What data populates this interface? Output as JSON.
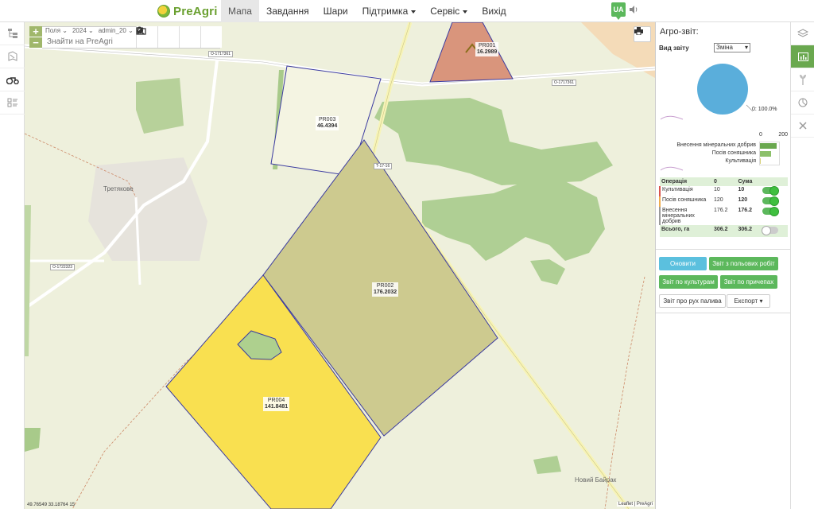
{
  "app": {
    "logo_text": "PreAgri"
  },
  "nav": {
    "items": [
      {
        "label": "Мапа",
        "active": true,
        "dropdown": false
      },
      {
        "label": "Завдання",
        "active": false,
        "dropdown": false
      },
      {
        "label": "Шари",
        "active": false,
        "dropdown": false
      },
      {
        "label": "Підтримка",
        "active": false,
        "dropdown": true
      },
      {
        "label": "Сервіс",
        "active": false,
        "dropdown": true
      },
      {
        "label": "Вихід",
        "active": false,
        "dropdown": false
      }
    ],
    "lang": "UA"
  },
  "left_toolbar": {
    "icons": [
      "fields-tree-icon",
      "map-layers-icon",
      "tractor-icon",
      "fields-list-icon"
    ]
  },
  "map": {
    "zoom_in": "+",
    "zoom_out": "−",
    "filters": {
      "type": "Поля",
      "year": "2024",
      "user": "admin_20"
    },
    "search_placeholder": "Знайти на PreAgri",
    "tools": [
      "search-icon",
      "locate-icon",
      "ruler-icon",
      "folder-icon"
    ],
    "fields": [
      {
        "id": "PR001",
        "area": "16.2989"
      },
      {
        "id": "PR002",
        "area": "176.2032"
      },
      {
        "id": "PR003",
        "area": "46.4394"
      },
      {
        "id": "PR004",
        "area": "141.8481"
      }
    ],
    "roads": [
      "O-1717361",
      "O-1717361",
      "O-1722323",
      "T-17-16"
    ],
    "places": [
      "Третякове",
      "Новий Байрак"
    ],
    "coordinates": "49.76549 33.18764 15",
    "attribution": "Leaflet | PreAgri"
  },
  "report": {
    "title": "Агро-звіт:",
    "view_label": "Вид звіту",
    "view_value": "Зміна",
    "pie": {
      "label": "0: 100.0%",
      "color": "#5aaedb"
    },
    "bar_axis": [
      "0",
      "200"
    ],
    "bars": [
      {
        "label": "Внесення мінеральних добрив",
        "value": 176.2
      },
      {
        "label": "Посів соняшника",
        "value": 120
      },
      {
        "label": "Культивація",
        "value": 10
      }
    ],
    "table": {
      "headers": [
        "Операція",
        "0",
        "Сума"
      ],
      "rows": [
        {
          "name": "Культивація",
          "value": "10",
          "sum": "10",
          "color": "#d9534f",
          "enabled": true
        },
        {
          "name": "Посів соняшника",
          "value": "120",
          "sum": "120",
          "color": "#f0ad4e",
          "enabled": true
        },
        {
          "name": "Внесення мінеральних добрив",
          "value": "176.2",
          "sum": "176.2",
          "color": "#999999",
          "enabled": true
        }
      ],
      "total": {
        "label": "Всього, га",
        "value": "306.2",
        "sum": "306.2",
        "enabled": false
      }
    },
    "buttons": {
      "refresh": "Оновити",
      "field_works": "Звіт з польових робіт",
      "by_crops": "Звіт по культурам",
      "by_trailers": "Звіт по причепах",
      "fuel": "Звіт про рух палива",
      "export": "Експорт"
    }
  },
  "right_toolbar": {
    "icons": [
      "layers-icon",
      "chart-icon",
      "plant-icon",
      "pie-chart-icon",
      "tools-icon"
    ]
  }
}
